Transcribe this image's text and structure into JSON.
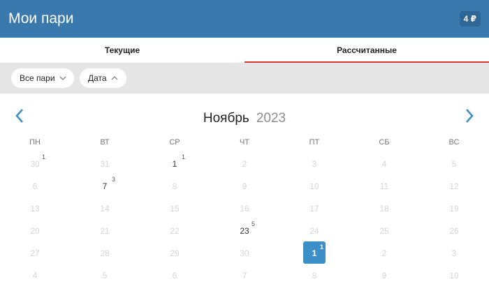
{
  "header": {
    "title": "Мои пари",
    "balance": "4 ₽"
  },
  "tabs": [
    {
      "label": "Текущие",
      "active": false
    },
    {
      "label": "Рассчитанные",
      "active": true
    }
  ],
  "filters": {
    "all_label": "Все пари",
    "date_label": "Дата"
  },
  "calendar": {
    "month": "Ноябрь",
    "year": "2023",
    "weekdays": [
      "ПН",
      "ВТ",
      "СР",
      "ЧТ",
      "ПТ",
      "СБ",
      "ВС"
    ],
    "weeks": [
      [
        {
          "d": "30",
          "active": false,
          "count": "1"
        },
        {
          "d": "31",
          "active": false,
          "count": ""
        },
        {
          "d": "1",
          "active": true,
          "count": "1"
        },
        {
          "d": "2",
          "active": false,
          "count": ""
        },
        {
          "d": "3",
          "active": false,
          "count": ""
        },
        {
          "d": "4",
          "active": false,
          "count": ""
        },
        {
          "d": "5",
          "active": false,
          "count": ""
        }
      ],
      [
        {
          "d": "6",
          "active": false,
          "count": ""
        },
        {
          "d": "7",
          "active": true,
          "count": "3"
        },
        {
          "d": "8",
          "active": false,
          "count": ""
        },
        {
          "d": "9",
          "active": false,
          "count": ""
        },
        {
          "d": "10",
          "active": false,
          "count": ""
        },
        {
          "d": "11",
          "active": false,
          "count": ""
        },
        {
          "d": "12",
          "active": false,
          "count": ""
        }
      ],
      [
        {
          "d": "13",
          "active": false,
          "count": ""
        },
        {
          "d": "14",
          "active": false,
          "count": ""
        },
        {
          "d": "15",
          "active": false,
          "count": ""
        },
        {
          "d": "16",
          "active": false,
          "count": ""
        },
        {
          "d": "17",
          "active": false,
          "count": ""
        },
        {
          "d": "18",
          "active": false,
          "count": ""
        },
        {
          "d": "19",
          "active": false,
          "count": ""
        }
      ],
      [
        {
          "d": "20",
          "active": false,
          "count": ""
        },
        {
          "d": "21",
          "active": false,
          "count": ""
        },
        {
          "d": "22",
          "active": false,
          "count": ""
        },
        {
          "d": "23",
          "active": true,
          "count": "5"
        },
        {
          "d": "24",
          "active": false,
          "count": ""
        },
        {
          "d": "25",
          "active": false,
          "count": ""
        },
        {
          "d": "26",
          "active": false,
          "count": ""
        }
      ],
      [
        {
          "d": "27",
          "active": false,
          "count": ""
        },
        {
          "d": "28",
          "active": false,
          "count": ""
        },
        {
          "d": "29",
          "active": false,
          "count": ""
        },
        {
          "d": "30",
          "active": false,
          "count": ""
        },
        {
          "d": "1",
          "active": true,
          "selected": true,
          "count": "1"
        },
        {
          "d": "2",
          "active": false,
          "count": ""
        },
        {
          "d": "3",
          "active": false,
          "count": ""
        }
      ],
      [
        {
          "d": "4",
          "active": false,
          "count": ""
        },
        {
          "d": "5",
          "active": false,
          "count": ""
        },
        {
          "d": "6",
          "active": false,
          "count": ""
        },
        {
          "d": "7",
          "active": false,
          "count": ""
        },
        {
          "d": "8",
          "active": false,
          "count": ""
        },
        {
          "d": "9",
          "active": false,
          "count": ""
        },
        {
          "d": "10",
          "active": false,
          "count": ""
        }
      ]
    ]
  },
  "colors": {
    "header": "#3a79ad",
    "accent_tab": "#d0392b",
    "selected_day": "#3d8fc7",
    "nav_arrow": "#3d8fc7"
  },
  "icons": {
    "prev": "chevron-left-icon",
    "next": "chevron-right-icon",
    "filter_chevron": "chevron-down-icon"
  }
}
